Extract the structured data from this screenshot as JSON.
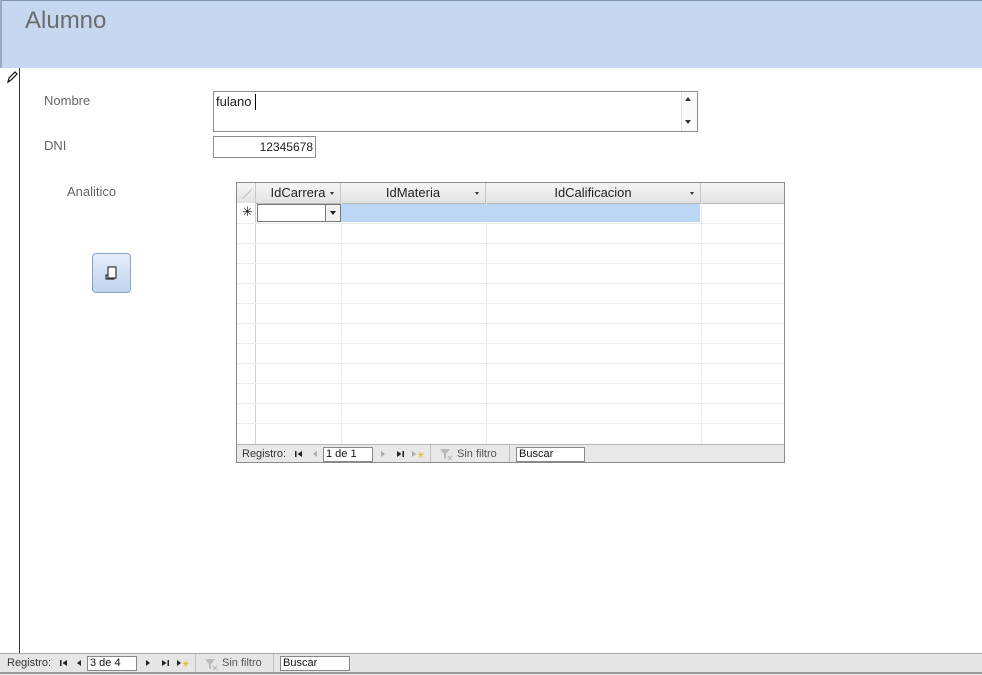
{
  "form": {
    "title": "Alumno",
    "fields": {
      "nombre": {
        "label": "Nombre",
        "value": "fulano"
      },
      "dni": {
        "label": "DNI",
        "value": "12345678"
      },
      "analitico": {
        "label": "Analitico"
      }
    }
  },
  "subform": {
    "columns": [
      "IdCarrera",
      "IdMateria",
      "IdCalificacion"
    ],
    "new_row_marker": "✳",
    "navigation": {
      "label": "Registro:",
      "position": "1 de 1",
      "filter": "Sin filtro",
      "search_placeholder": "Buscar"
    }
  },
  "navigation": {
    "label": "Registro:",
    "position": "3 de 4",
    "filter": "Sin filtro",
    "search_placeholder": "Buscar"
  },
  "colors": {
    "header_background": "#c5d8ef",
    "selected_row": "#bcd7f4",
    "button": "#c0d3ee"
  },
  "icons": [
    "pencil-icon",
    "scroll-up-icon",
    "scroll-down-icon",
    "report-icon",
    "first-record-icon",
    "previous-record-icon",
    "next-record-icon",
    "last-record-icon",
    "new-record-icon",
    "filter-icon"
  ]
}
